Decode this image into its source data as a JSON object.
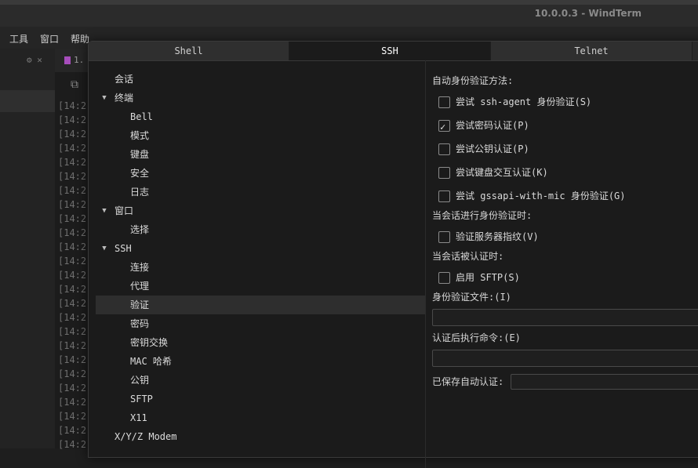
{
  "window": {
    "title": "10.0.0.3 - WindTerm"
  },
  "menu": [
    "工具",
    "窗口",
    "帮助"
  ],
  "sessions_panel": {
    "tools": "⚙ ✕"
  },
  "terminal": {
    "tab_label": "1.",
    "log_prefix": "[14:2",
    "line_count": 25
  },
  "dialog": {
    "tabs": [
      {
        "label": "Shell",
        "active": false
      },
      {
        "label": "SSH",
        "active": true
      },
      {
        "label": "Telnet",
        "active": false
      }
    ],
    "tree": [
      {
        "label": "会话",
        "level": 0,
        "expandable": false
      },
      {
        "label": "终端",
        "level": 0,
        "expandable": true
      },
      {
        "label": "Bell",
        "level": 1
      },
      {
        "label": "模式",
        "level": 1
      },
      {
        "label": "键盘",
        "level": 1
      },
      {
        "label": "安全",
        "level": 1
      },
      {
        "label": "日志",
        "level": 1
      },
      {
        "label": "窗口",
        "level": 0,
        "expandable": true
      },
      {
        "label": "选择",
        "level": 1
      },
      {
        "label": "SSH",
        "level": 0,
        "expandable": true
      },
      {
        "label": "连接",
        "level": 1
      },
      {
        "label": "代理",
        "level": 1
      },
      {
        "label": "验证",
        "level": 1,
        "selected": true
      },
      {
        "label": "密码",
        "level": 1
      },
      {
        "label": "密钥交换",
        "level": 1
      },
      {
        "label": "MAC 哈希",
        "level": 1
      },
      {
        "label": "公钥",
        "level": 1
      },
      {
        "label": "SFTP",
        "level": 1
      },
      {
        "label": "X11",
        "level": 1
      },
      {
        "label": "X/Y/Z Modem",
        "level": 0,
        "expandable": false
      }
    ],
    "auth": {
      "auto_auth_label": "自动身份验证方法:",
      "methods": [
        {
          "label": "尝试 ssh-agent 身份验证(S)",
          "checked": false
        },
        {
          "label": "尝试密码认证(P)",
          "checked": true
        },
        {
          "label": "尝试公钥认证(P)",
          "checked": false
        },
        {
          "label": "尝试键盘交互认证(K)",
          "checked": false
        },
        {
          "label": "尝试 gssapi-with-mic 身份验证(G)",
          "checked": false
        }
      ],
      "during_auth_label": "当会话进行身份验证时:",
      "verify_fingerprint": {
        "label": "验证服务器指纹(V)",
        "checked": false
      },
      "after_auth_label": "当会话被认证时:",
      "enable_sftp": {
        "label": "启用 SFTP(S)",
        "checked": false
      },
      "identity_file_label": "身份验证文件:(I)",
      "identity_file_value": "",
      "post_cmd_label": "认证后执行命令:(E)",
      "post_cmd_value": "",
      "saved_auth_label": "已保存自动认证:",
      "saved_auth_value": ""
    }
  }
}
